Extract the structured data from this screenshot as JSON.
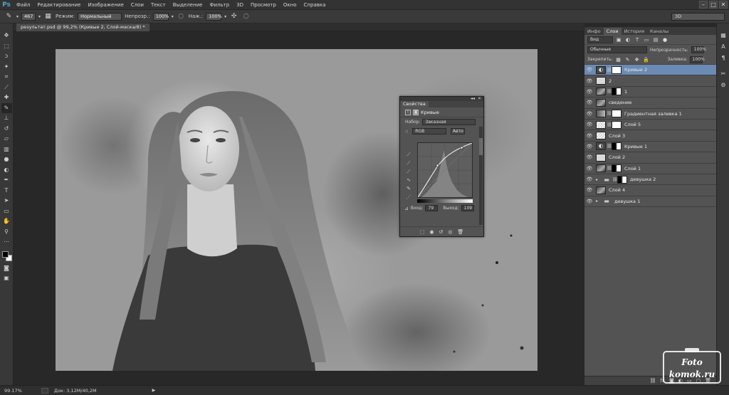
{
  "app": {
    "logo": "Ps"
  },
  "menubar": {
    "items": [
      "Файл",
      "Редактирование",
      "Изображение",
      "Слои",
      "Текст",
      "Выделение",
      "Фильтр",
      "3D",
      "Просмотр",
      "Окно",
      "Справка"
    ],
    "window_buttons": [
      "–",
      "□",
      "✕"
    ]
  },
  "options_bar": {
    "brush_size": "467",
    "mode_label": "Режим:",
    "mode_value": "Нормальный",
    "opacity_label": "Непрозр.:",
    "opacity_value": "100%",
    "flow_label": "Наж.:",
    "flow_value": "100%",
    "workspace": "3D"
  },
  "document": {
    "tab_title": "результат.psd @ 99,2% (Кривые 2, Слой-маска/8) *"
  },
  "status_bar": {
    "zoom": "99.17%",
    "doc_info": "Док: 3,12M/40,2M"
  },
  "panels": {
    "tabs": [
      "Инфо",
      "Слои",
      "История",
      "Каналы"
    ],
    "active_tab": "Слои",
    "filter_kind": "Вид",
    "blend_mode": "Обычные",
    "opacity_label": "Непрозрачность:",
    "opacity_value": "100%",
    "lock_label": "Закрепить:",
    "fill_label": "Заливка:",
    "fill_value": "100%",
    "layers": [
      {
        "name": "Кривые 2",
        "thumb": "adj",
        "mask": "white",
        "selected": true
      },
      {
        "name": "2",
        "thumb": "light",
        "mask": null,
        "selected": false
      },
      {
        "name": "1",
        "thumb": "photo",
        "mask": "mask-dark",
        "selected": false
      },
      {
        "name": "сведение",
        "thumb": "photo",
        "mask": null,
        "selected": false
      },
      {
        "name": "Градиентная заливка 1",
        "thumb": "gray",
        "mask": "white",
        "selected": false
      },
      {
        "name": "Слой 5",
        "thumb": "check",
        "mask": "white",
        "selected": false
      },
      {
        "name": "Слой 3",
        "thumb": "check",
        "mask": null,
        "selected": false
      },
      {
        "name": "Кривые 1",
        "thumb": "adj",
        "mask": "mask-dark",
        "selected": false
      },
      {
        "name": "Слой 2",
        "thumb": "light",
        "mask": null,
        "selected": false
      },
      {
        "name": "Слой 1",
        "thumb": "photo",
        "mask": "mask-dark",
        "selected": false
      },
      {
        "name": "девушка 2",
        "thumb": "folder",
        "mask": "mask-dark",
        "selected": false,
        "group": true
      },
      {
        "name": "Слой 4",
        "thumb": "photo",
        "mask": null,
        "selected": false
      },
      {
        "name": "девушка 1",
        "thumb": "folder",
        "mask": null,
        "selected": false,
        "group": true
      }
    ]
  },
  "properties": {
    "title": "Свойства",
    "adjustment": "Кривые",
    "preset_label": "Набор:",
    "preset_value": "Заказная",
    "channel": "RGB",
    "auto_label": "Авто",
    "input_label": "Вход:",
    "input_value": "79",
    "output_label": "Выход:",
    "output_value": "109"
  },
  "watermark": {
    "line1": "Foto",
    "line2": "komok.ru"
  },
  "icons": [
    "move-icon",
    "marquee-icon",
    "lasso-icon",
    "magic-wand-icon",
    "crop-icon",
    "eyedropper-icon",
    "healing-icon",
    "brush-icon",
    "stamp-icon",
    "history-brush-icon",
    "eraser-icon",
    "gradient-icon",
    "blur-icon",
    "dodge-icon",
    "pen-icon",
    "type-icon",
    "path-select-icon",
    "shape-icon",
    "hand-icon",
    "zoom-icon"
  ]
}
